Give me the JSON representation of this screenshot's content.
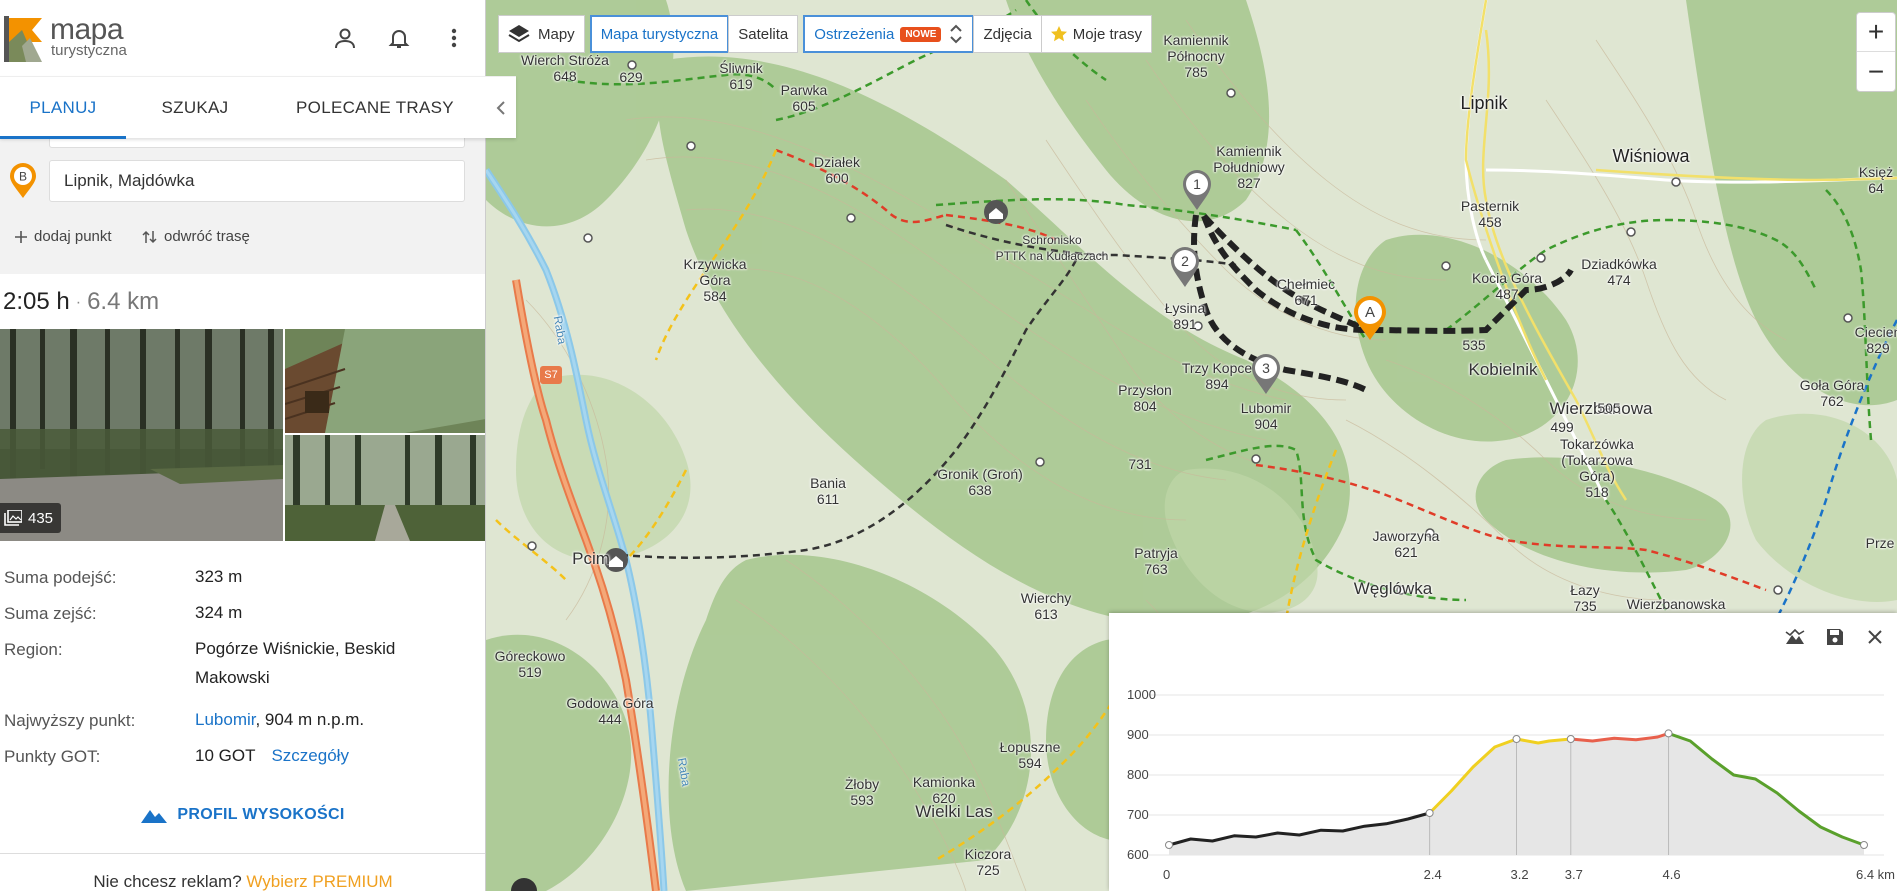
{
  "app": {
    "logo_line1": "mapa",
    "logo_line2": "turystyczna"
  },
  "tabs": [
    {
      "label": "PLANUJ",
      "active": true
    },
    {
      "label": "SZUKAJ",
      "active": false
    },
    {
      "label": "POLECANE TRASY",
      "active": false
    }
  ],
  "planner": {
    "destination_marker": "B",
    "destination_value": "Lipnik, Majdówka",
    "add_point_label": "dodaj punkt",
    "reverse_label": "odwróć trasę"
  },
  "summary": {
    "time": "2:05 h",
    "separator": "·",
    "distance": "6.4 km"
  },
  "photos": {
    "count": "435"
  },
  "stats": {
    "ascent_label": "Suma podejść:",
    "ascent_value": "323 m",
    "descent_label": "Suma zejść:",
    "descent_value": "324 m",
    "region_label": "Region:",
    "region_value": "Pogórze Wiśnickie, Beskid Makowski",
    "highest_label": "Najwyższy punkt:",
    "highest_link": "Lubomir",
    "highest_rest": ", 904 m n.p.m.",
    "got_label": "Punkty GOT:",
    "got_value": "10 GOT",
    "got_link": "Szczegóły"
  },
  "profile_button": "PROFIL WYSOKOŚCI",
  "premium": {
    "text": "Nie chcesz reklam?",
    "cta": "Wybierz PREMIUM"
  },
  "map_layers": {
    "base": "Mapy",
    "tourist": "Mapa turystyczna",
    "satellite": "Satelita",
    "warnings": "Ostrzeżenia",
    "new_badge": "NOWE",
    "photos": "Zdjęcia",
    "my_routes": "Moje trasy"
  },
  "zoom": {
    "in": "+",
    "out": "−"
  },
  "route_markers": [
    "1",
    "2",
    "3",
    "A"
  ],
  "map_labels": {
    "wierch_stroza": "Wierch Stróża",
    "wierch_stroza_h": "648",
    "h629": "629",
    "sliwnik": "Śliwnik",
    "sliwnik_h": "619",
    "parwka": "Parwka",
    "parwka_h": "605",
    "dzialek": "Działek",
    "dzialek_h": "600",
    "kam_pn": "Kamiennik",
    "kam_pn2": "Północny",
    "kam_pn_h": "785",
    "kam_pd": "Kamiennik",
    "kam_pd2": "Południowy",
    "kam_pd_h": "827",
    "lipnik": "Lipnik",
    "wisniowa": "Wiśniowa",
    "pasternik": "Pasternik",
    "pasternik_h": "458",
    "ksiez": "Księż",
    "ksiez_h": "64",
    "schronisko": "Schronisko",
    "schronisko2": "PTTK na Kudłaczach",
    "krzywicka": "Krzywicka",
    "krzywicka2": "Góra",
    "krzywicka_h": "584",
    "lysina": "Łysina",
    "lysina_h": "891",
    "chelmiec": "Chełmiec",
    "chelmiec_h": "671",
    "kocia": "Kocia Góra",
    "kocia_h": "487",
    "dziadkowka": "Dziadkówka",
    "dziadkowka_h": "474",
    "ciecien": "Ciecień",
    "ciecien_h": "829",
    "h535": "535",
    "kobielnik": "Kobielnik",
    "trzy_kopce": "Trzy Kopce",
    "trzy_kopce_h": "894",
    "lubomir": "Lubomir",
    "lubomir_h": "904",
    "przyslon": "Przysłon",
    "przyslon_h": "804",
    "wierzbanowa": "Wierzbanowa",
    "gola": "Goła Góra",
    "gola_h": "762",
    "h505": "505",
    "h499": "499",
    "tokarzowka": "Tokarzówka",
    "tokarzowka2": "(Tokarzowa",
    "tokarzowka3": "Góra)",
    "tokarzowka_h": "518",
    "h731": "731",
    "gronik": "Gronik (Groń)",
    "gronik_h": "638",
    "bania": "Bania",
    "bania_h": "611",
    "road": "S7",
    "raba": "Raba",
    "jaworzyna": "Jaworzyna",
    "jaworzyna_h": "621",
    "prze": "Prze",
    "pcim": "Pcim",
    "patryja": "Patryja",
    "patryja_h": "763",
    "weglowka": "Węglówka",
    "lazy": "Łazy",
    "lazy_h": "735",
    "wierzbanowska": "Wierzbanowska",
    "wierchy": "Wierchy",
    "wierchy_h": "613",
    "goreckowo": "Góreckowo",
    "goreckowo_h": "519",
    "godowa": "Godowa Góra",
    "godowa_h": "444",
    "lopuszne": "Łopuszne",
    "lopuszne_h": "594",
    "zloby": "Żłoby",
    "zloby_h": "593",
    "kamionka": "Kamionka",
    "kamionka_h": "620",
    "wielki_las": "Wielki Las",
    "kiczora": "Kiczora",
    "kiczora_h": "725",
    "raba2": "Raba"
  },
  "elevation_profile": {
    "y_labels": [
      "1000",
      "900",
      "800",
      "700",
      "600"
    ],
    "x_labels": [
      "0",
      "2.4",
      "3.2",
      "3.7",
      "4.6",
      "6.4 km"
    ],
    "y_range": [
      600,
      1000
    ],
    "x_range": [
      0,
      6.4
    ],
    "colors": {
      "black": "#222222",
      "yellow": "#f0d020",
      "red": "#e8604c",
      "green": "#5aa02c"
    }
  },
  "colors": {
    "accent": "#1a73c8",
    "orange": "#f39200",
    "warning_badge": "#e8501c",
    "premium": "#f0a020"
  }
}
